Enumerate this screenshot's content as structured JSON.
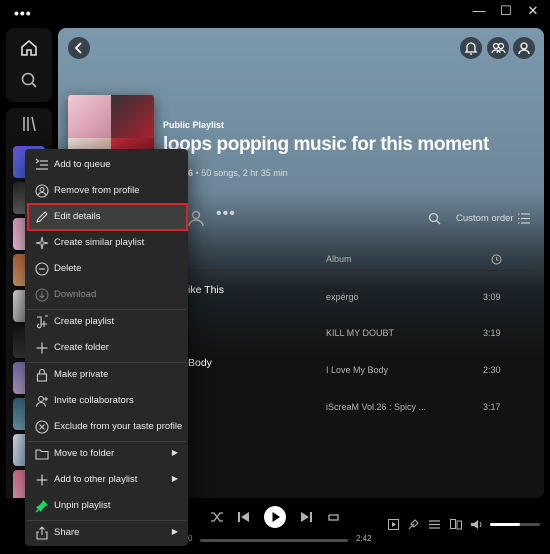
{
  "titlebar": {
    "more": "•••",
    "minimize": "—",
    "maximize": "☐",
    "close": "✕"
  },
  "playlist": {
    "type": "Public Playlist",
    "title": "loops popping music for this moment",
    "owner": "314556",
    "stats": " • 50 songs, 2 hr 35 min"
  },
  "toolbar": {
    "more": "•••",
    "sort_label": "Custom order"
  },
  "table": {
    "album_header": "Album",
    "rows": [
      {
        "title": "ike This",
        "album": "expérgo",
        "duration": "3:09"
      },
      {
        "title": "",
        "album": "KILL MY DOUBT",
        "duration": "3:19"
      },
      {
        "title": "Body",
        "album": "I Love My Body",
        "duration": "2:30"
      },
      {
        "title": "",
        "album": "iScreaM Vol.26 : Spicy ...",
        "duration": "3:17"
      }
    ]
  },
  "player": {
    "elapsed": "0",
    "total": "2:42",
    "volume_fraction": 0.6,
    "progress_fraction": 0.0
  },
  "context_menu": {
    "items": [
      {
        "label": "Add to queue",
        "icon": "add-to-queue-icon"
      },
      {
        "label": "Remove from profile",
        "icon": "profile-icon"
      },
      {
        "label": "Edit details",
        "icon": "pencil-icon",
        "highlighted": true
      },
      {
        "label": "Create similar playlist",
        "icon": "sparkle-icon"
      },
      {
        "label": "Delete",
        "icon": "minus-circle-icon"
      },
      {
        "label": "Download",
        "icon": "download-icon",
        "disabled": true
      },
      {
        "label": "Create playlist",
        "icon": "music-note-plus-icon"
      },
      {
        "label": "Create folder",
        "icon": "plus-icon"
      },
      {
        "label": "Make private",
        "icon": "lock-icon"
      },
      {
        "label": "Invite collaborators",
        "icon": "add-person-icon"
      },
      {
        "label": "Exclude from your taste profile",
        "icon": "x-circle-icon"
      },
      {
        "label": "Move to folder",
        "icon": "folder-icon",
        "submenu": true
      },
      {
        "label": "Add to other playlist",
        "icon": "plus-icon",
        "submenu": true
      },
      {
        "label": "Unpin playlist",
        "icon": "pin-icon"
      },
      {
        "label": "Share",
        "icon": "share-icon",
        "submenu": true
      }
    ],
    "highlight_color": "#d7232a",
    "pin_color": "#1ed760"
  },
  "colors": {
    "accent": "#1ed760",
    "header_gradient": "#7c98ac",
    "background": "#121212"
  }
}
